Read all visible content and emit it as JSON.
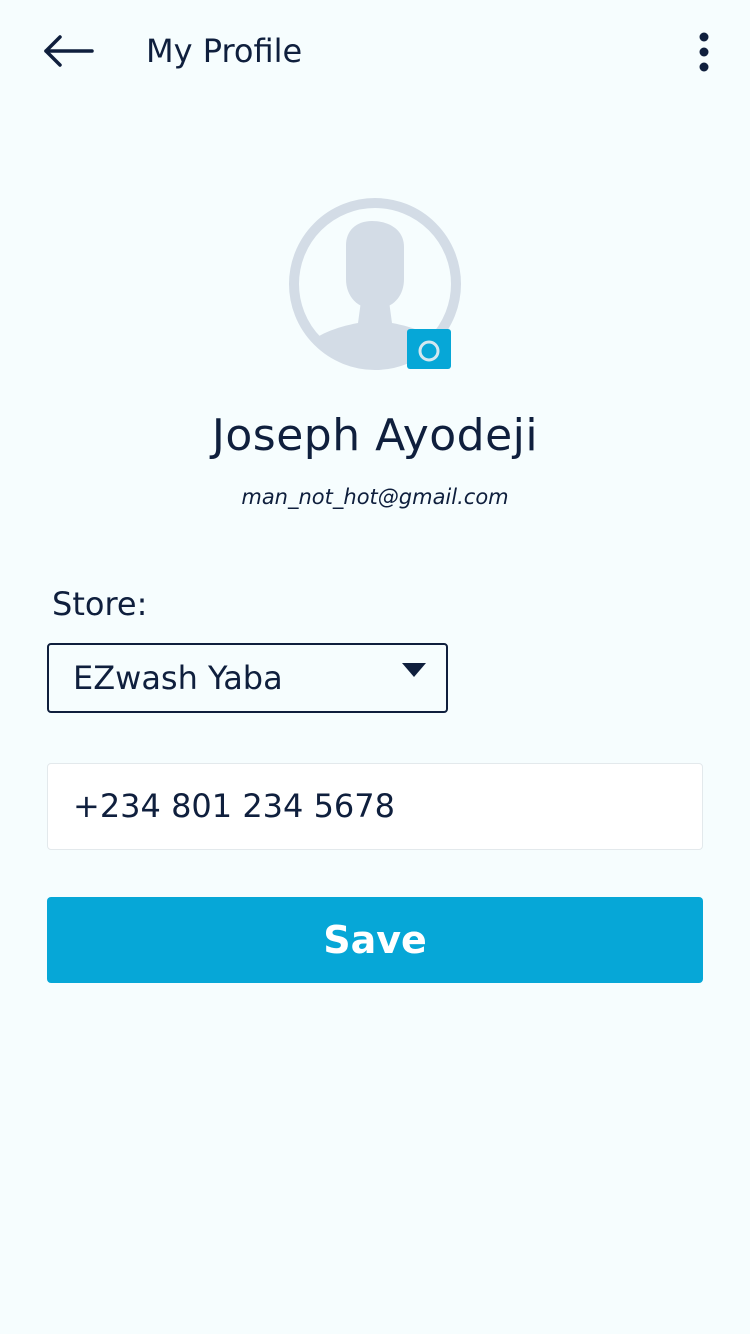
{
  "header": {
    "title": "My Profile",
    "back_icon": "arrow-left-icon",
    "menu_icon": "more-vertical-icon"
  },
  "profile": {
    "name": "Joseph Ayodeji",
    "email": "man_not_hot@gmail.com",
    "avatar_icon": "user-silhouette-icon",
    "camera_icon": "camera-icon"
  },
  "form": {
    "store_label": "Store:",
    "store_selected": "EZwash Yaba",
    "store_dropdown_icon": "caret-down-icon",
    "phone_value": "+234 801 234 5678"
  },
  "actions": {
    "save_label": "Save"
  },
  "colors": {
    "background": "#f6fdfe",
    "text": "#0f1f3d",
    "accent": "#06a7d7",
    "avatar_placeholder": "#d3dce6"
  }
}
